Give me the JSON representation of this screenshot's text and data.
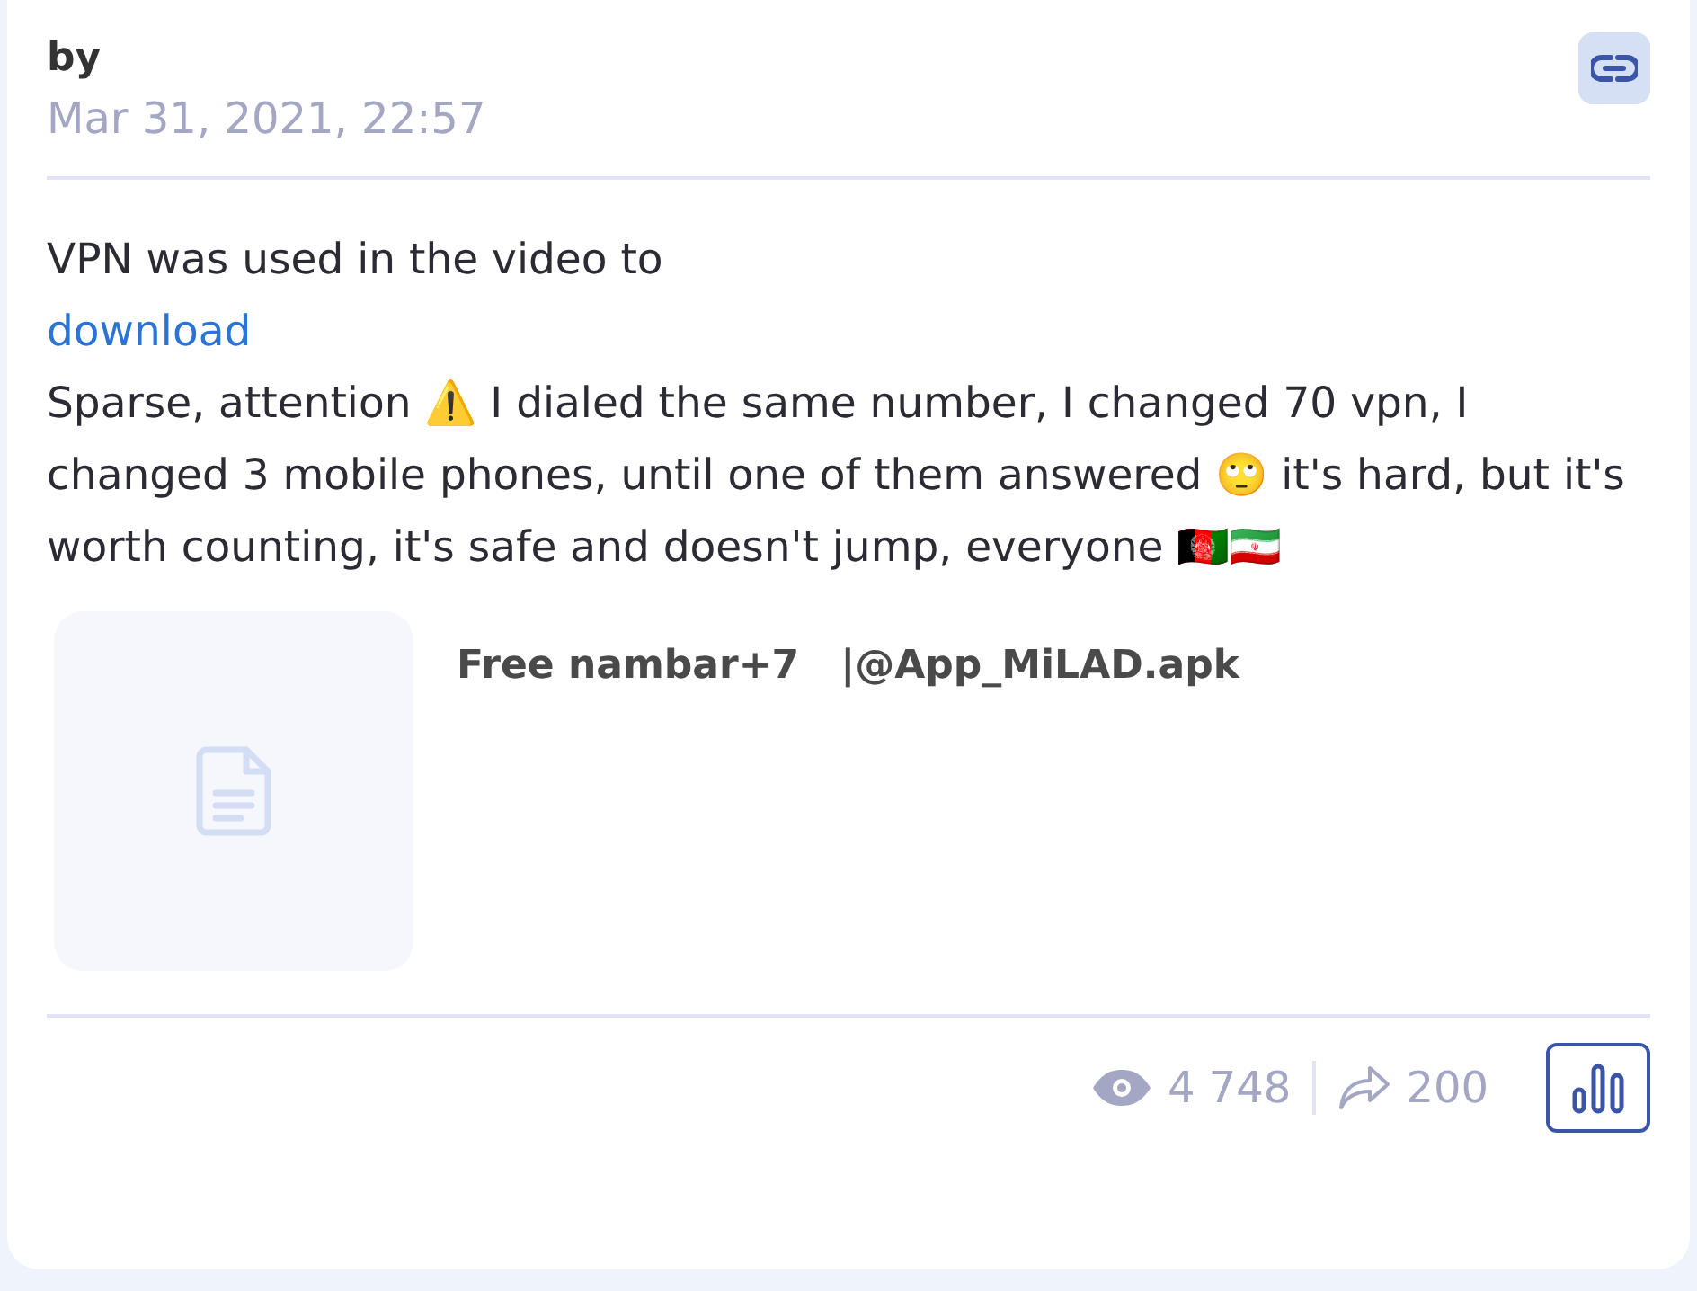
{
  "post": {
    "author": "by",
    "date": "Mar 31, 2021, 22:57",
    "text_before": "VPN was used in the video to",
    "link": "download",
    "text_after": "Sparse, attention ⚠️ I dialed the same number, I changed 70 vpn, I changed 3 mobile phones, until one of them answered 🙄 it's hard, but it's worth counting, it's safe and doesn't jump, everyone 🇦🇫🇮🇷",
    "file": {
      "name": "Free nambar+7   |@App_MiLAD.apk"
    },
    "views": "4 748",
    "shares": "200"
  }
}
